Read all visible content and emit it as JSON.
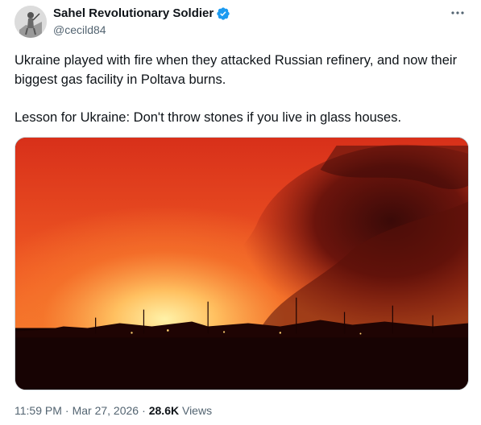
{
  "author": {
    "display_name": "Sahel Revolutionary Soldier",
    "handle": "@cecild84",
    "verified": true,
    "avatar_icon": "soldier-avatar"
  },
  "more_icon": "more-options-icon",
  "tweet": {
    "text_paragraph_1": "Ukraine played with fire when they attacked Russian refinery, and now their biggest gas facility in Poltava burns.",
    "text_paragraph_2": "Lesson for Ukraine: Don't throw stones if you live in glass houses."
  },
  "media": {
    "type": "photo",
    "subject": "nighttime fire with large smoke plume over industrial facility"
  },
  "meta": {
    "time": "11:59 PM",
    "date": "Mar 27, 2026",
    "views_count": "28.6K",
    "views_label": "Views",
    "separator": "·"
  },
  "colors": {
    "verified_blue": "#1d9bf0",
    "secondary_text": "#536471",
    "primary_text": "#0f1419"
  }
}
